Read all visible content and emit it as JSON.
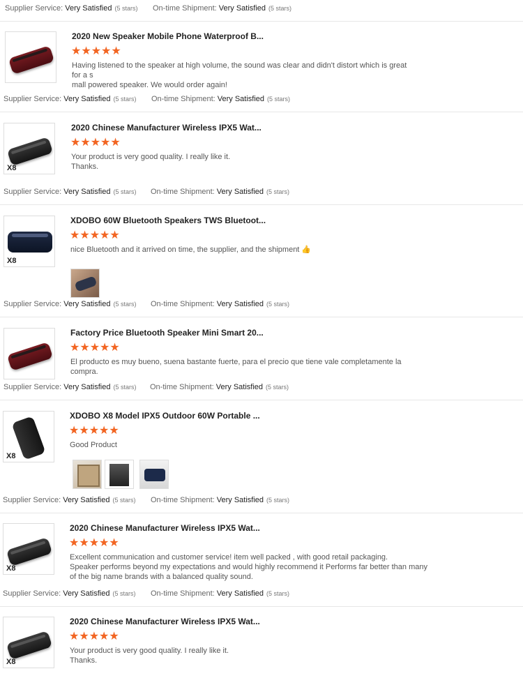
{
  "labels": {
    "supplier_service": "Supplier Service:",
    "ontime_shipment": "On-time Shipment:",
    "very_satisfied": "Very Satisfied",
    "five_stars": "(5 stars)",
    "badge_x8": "X8"
  },
  "stars_glyph": "★★★★★",
  "star_color": "#f26522",
  "reviews": [
    {
      "title": "2020 New Speaker Mobile Phone Waterproof B...",
      "rating": 5,
      "text_lines": [
        "Having listened to the speaker at high volume, the sound was clear and didn't distort which is great for a s",
        "mall powered speaker. We would order again!"
      ],
      "product_image": "red-speaker",
      "badge": ""
    },
    {
      "title": "2020 Chinese Manufacturer Wireless IPX5 Wat...",
      "rating": 5,
      "text_lines": [
        "Your product is very good quality. I really like it.",
        "Thanks."
      ],
      "product_image": "black-speaker",
      "badge": "X8"
    },
    {
      "title": "XDOBO 60W Bluetooth Speakers TWS Bluetoot...",
      "rating": 5,
      "text_lines": [
        "nice Bluetooth and it arrived on time, the supplier, and the shipment 👍"
      ],
      "product_image": "blue-speaker",
      "badge": "X8",
      "photos": [
        "speaker-photo"
      ]
    },
    {
      "title": "Factory Price Bluetooth Speaker Mini Smart 20...",
      "rating": 5,
      "text_lines": [
        "El producto es muy bueno, suena bastante fuerte, para el precio que tiene vale completamente la compra."
      ],
      "product_image": "red-speaker",
      "badge": ""
    },
    {
      "title": "XDOBO X8 Model IPX5 Outdoor 60W Portable ...",
      "rating": 5,
      "text_lines": [
        "Good Product"
      ],
      "product_image": "black-speaker-tall",
      "badge": "X8",
      "photos": [
        "package-photo",
        "box-photo",
        "speaker-photo"
      ]
    },
    {
      "title": "2020 Chinese Manufacturer Wireless IPX5 Wat...",
      "rating": 5,
      "text_lines": [
        "Excellent communication and customer service! item well packed , with good retail packaging.",
        "Speaker performs beyond my expectations and would highly recommend it Performs far better than  many",
        "of the big name brands with a balanced quality sound."
      ],
      "product_image": "black-speaker",
      "badge": "X8"
    },
    {
      "title": "2020 Chinese Manufacturer Wireless IPX5 Wat...",
      "rating": 5,
      "text_lines": [
        "Your product is very good quality. I really like it.",
        "Thanks."
      ],
      "product_image": "black-speaker",
      "badge": "X8"
    }
  ]
}
